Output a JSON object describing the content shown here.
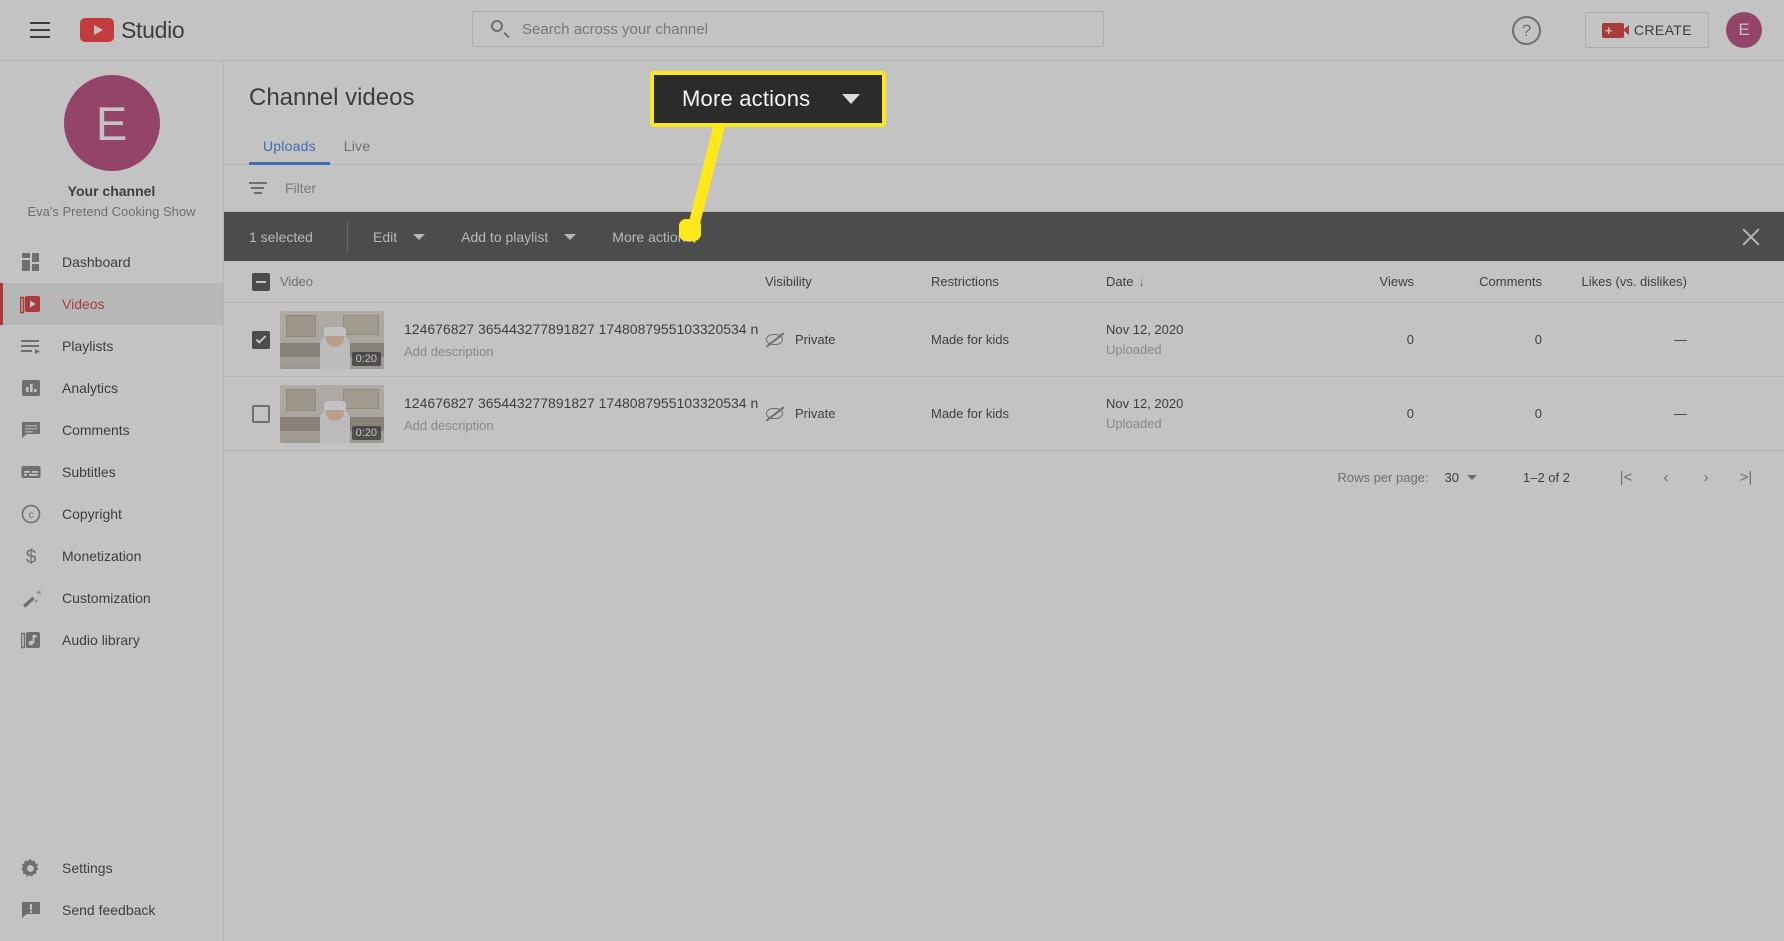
{
  "header": {
    "menu_icon": "hamburger-icon",
    "brand": "Studio",
    "logo_icon": "youtube-logo-icon",
    "search": {
      "value": "",
      "placeholder": "Search across your channel",
      "icon": "search-icon"
    },
    "help_icon": "help-circle-icon",
    "create_label": "CREATE",
    "create_icon": "video-camera-plus-icon",
    "avatar_letter": "E"
  },
  "sidebar": {
    "avatar_letter": "E",
    "channel_label": "Your channel",
    "channel_name": "Eva's Pretend Cooking Show",
    "items": [
      {
        "label": "Dashboard",
        "icon": "dashboard-grid-icon",
        "active": false
      },
      {
        "label": "Videos",
        "icon": "video-play-icon",
        "active": true
      },
      {
        "label": "Playlists",
        "icon": "playlist-icon",
        "active": false
      },
      {
        "label": "Analytics",
        "icon": "analytics-bar-icon",
        "active": false
      },
      {
        "label": "Comments",
        "icon": "comment-bubble-icon",
        "active": false
      },
      {
        "label": "Subtitles",
        "icon": "subtitles-icon",
        "active": false
      },
      {
        "label": "Copyright",
        "icon": "copyright-icon",
        "active": false
      },
      {
        "label": "Monetization",
        "icon": "dollar-sign-icon",
        "active": false
      },
      {
        "label": "Customization",
        "icon": "magic-wand-icon",
        "active": false
      },
      {
        "label": "Audio library",
        "icon": "music-note-icon",
        "active": false
      }
    ],
    "bottom_items": [
      {
        "label": "Settings",
        "icon": "gear-icon"
      },
      {
        "label": "Send feedback",
        "icon": "feedback-icon"
      }
    ]
  },
  "main": {
    "page_title": "Channel videos",
    "tabs": [
      {
        "label": "Uploads",
        "active": true
      },
      {
        "label": "Live",
        "active": false
      }
    ],
    "filter": {
      "placeholder": "Filter",
      "value": "",
      "icon": "filter-icon"
    },
    "selection_toolbar": {
      "count_label": "1 selected",
      "edit_label": "Edit",
      "add_to_playlist_label": "Add to playlist",
      "more_actions_label": "More actions",
      "close_icon": "close-icon",
      "caret_icon": "chevron-down-icon",
      "background": "#1f1f1f"
    },
    "table": {
      "columns": [
        "Video",
        "Visibility",
        "Restrictions",
        "Date",
        "Views",
        "Comments",
        "Likes (vs. dislikes)"
      ],
      "sort_column": "Date",
      "sort_direction_icon": "arrow-down-icon",
      "header_checkbox_state": "indeterminate",
      "rows": [
        {
          "checked": true,
          "duration": "0:20",
          "title": "124676827 365443277891827 1748087955103320534 n",
          "description": "Add description",
          "visibility": "Private",
          "visibility_icon": "eye-off-icon",
          "restrictions": "Made for kids",
          "date": "Nov 12, 2020",
          "date_sub": "Uploaded",
          "views": "0",
          "comments": "0",
          "likes": "—"
        },
        {
          "checked": false,
          "duration": "0:20",
          "title": "124676827 365443277891827 1748087955103320534 n",
          "description": "Add description",
          "visibility": "Private",
          "visibility_icon": "eye-off-icon",
          "restrictions": "Made for kids",
          "date": "Nov 12, 2020",
          "date_sub": "Uploaded",
          "views": "0",
          "comments": "0",
          "likes": "—"
        }
      ]
    },
    "pagination": {
      "rows_per_page_label": "Rows per page:",
      "rows_per_page_value": "30",
      "range_label": "1–2 of 2",
      "first_icon": "|<",
      "prev_icon": "‹",
      "next_icon": "›",
      "last_icon": ">|"
    }
  },
  "callout": {
    "label": "More actions",
    "caret_icon": "chevron-down-icon",
    "border_color": "#ffe81a",
    "background_color": "#2b2b2b",
    "pointer_color": "#ffe81a"
  },
  "colors": {
    "brand_red": "#cc0000",
    "accent_blue": "#065fd4",
    "avatar_magenta": "#a61055",
    "highlight_yellow": "#ffe81a",
    "toolbar_dark": "#1f1f1f"
  }
}
